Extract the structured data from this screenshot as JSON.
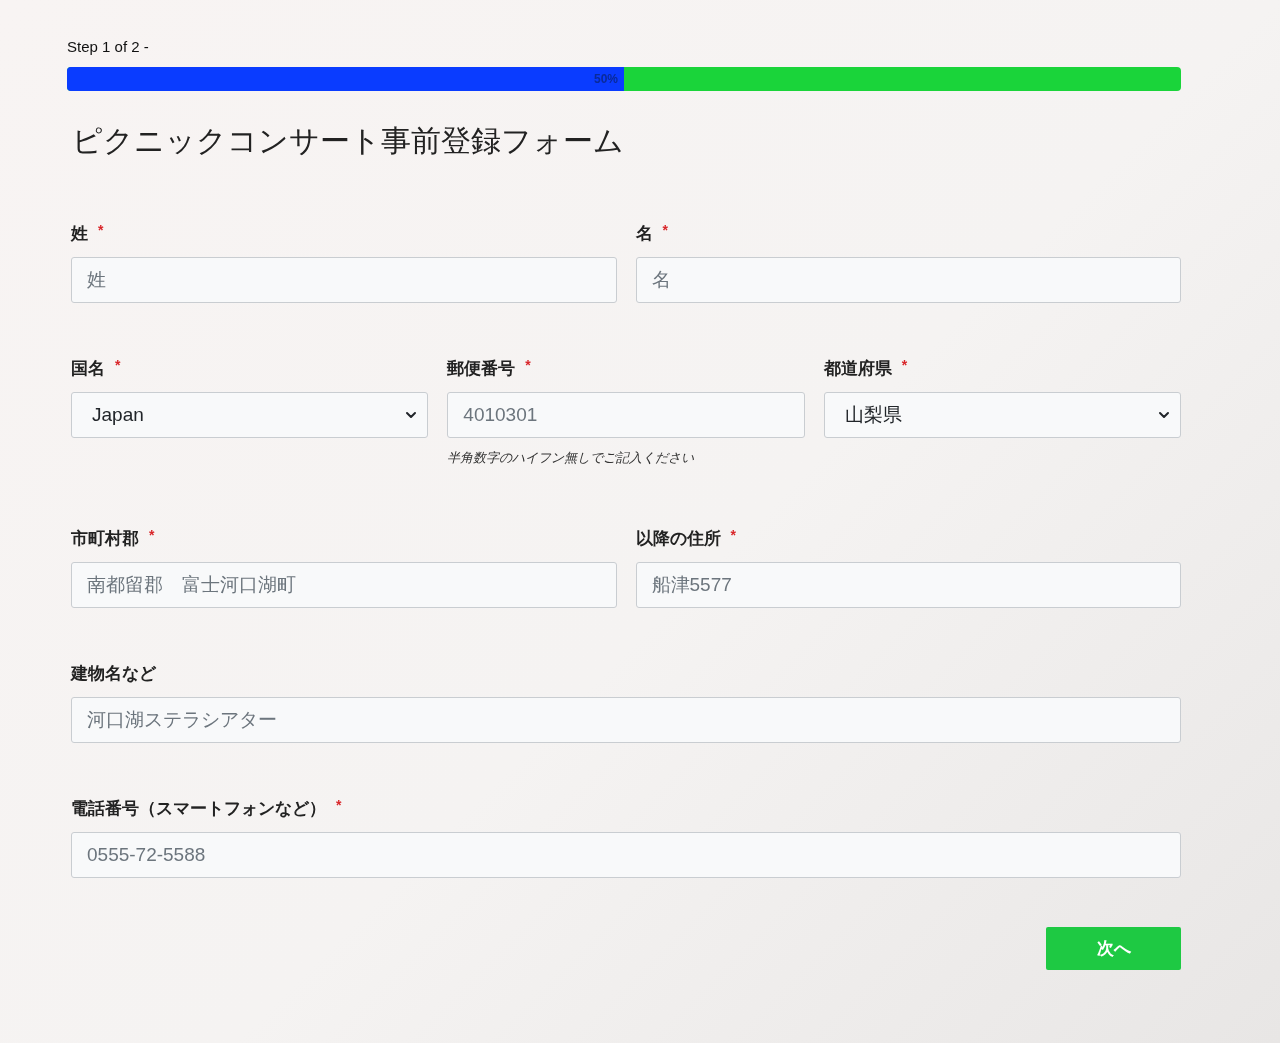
{
  "progress": {
    "step": "Step 1 of 2 -",
    "level": 0.5,
    "reading": "50%"
  },
  "title": "ピクニックコンサート事前登録フォーム",
  "rows": [
    {
      "fields": [
        {
          "label": "姓",
          "required_mark": "*",
          "kind": "text",
          "placeholder": "姓"
        },
        {
          "label": "名",
          "required_mark": "*",
          "kind": "text",
          "placeholder": "名"
        }
      ]
    },
    {
      "fields": [
        {
          "label": "国名",
          "required_mark": "*",
          "kind": "select",
          "value": "Japan"
        },
        {
          "label": "郵便番号",
          "required_mark": "*",
          "kind": "text",
          "placeholder": "4010301",
          "hint": "半角数字のハイフン無しでご記入ください"
        },
        {
          "label": "都道府県",
          "required_mark": "*",
          "kind": "select",
          "value": "山梨県"
        }
      ]
    },
    {
      "fields": [
        {
          "label": "市町村郡",
          "required_mark": "*",
          "kind": "text",
          "placeholder": "南都留郡　富士河口湖町"
        },
        {
          "label": "以降の住所",
          "required_mark": "*",
          "kind": "text",
          "placeholder": "船津5577"
        }
      ]
    },
    {
      "fields": [
        {
          "label": "建物名など",
          "kind": "text",
          "placeholder": "河口湖ステラシアター"
        }
      ]
    },
    {
      "fields": [
        {
          "label": "電話番号（スマートフォンなど）",
          "required_mark": "*",
          "kind": "text",
          "placeholder": "0555-72-5588"
        }
      ]
    }
  ],
  "next_button": "次へ"
}
